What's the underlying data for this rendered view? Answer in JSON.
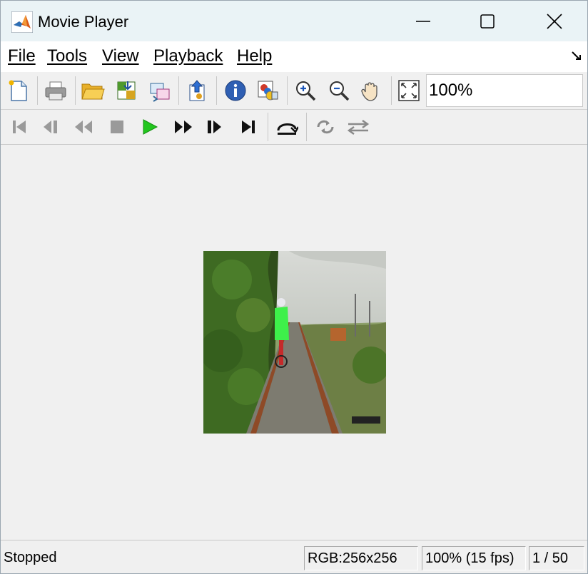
{
  "window": {
    "title": "Movie Player"
  },
  "menubar": {
    "items": [
      "File",
      "Tools",
      "View",
      "Playback",
      "Help"
    ]
  },
  "toolbar": {
    "zoom_value": "100%"
  },
  "statusbar": {
    "status": "Stopped",
    "image_info": "RGB:256x256",
    "zoom_fps": "100% (15 fps)",
    "frame": "1 / 50"
  }
}
